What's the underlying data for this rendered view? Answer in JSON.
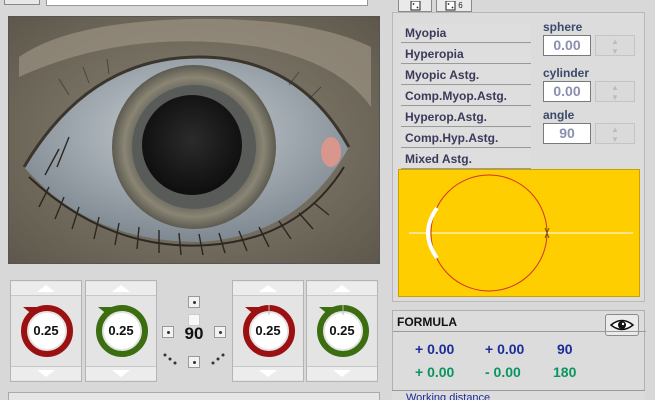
{
  "toolbar": {
    "dice_icon": "die-icon",
    "dice_multi_label": "6"
  },
  "diagnoses": [
    "Myopia",
    "Hyperopia",
    "Myopic Astg.",
    "Comp.Myop.Astg.",
    "Hyperop.Astg.",
    "Comp.Hyp.Astg.",
    "Mixed Astg."
  ],
  "params": {
    "sphere_label": "sphere",
    "sphere_value": "0.00",
    "cylinder_label": "cylinder",
    "cylinder_value": "0.00",
    "angle_label": "angle",
    "angle_value": "90"
  },
  "lenses": [
    {
      "value": "0.25",
      "color": "#9b1111"
    },
    {
      "value": "0.25",
      "color": "#3c6e11"
    },
    {
      "value": "0.25",
      "color": "#9b1111"
    },
    {
      "value": "0.25",
      "color": "#3c6e11"
    }
  ],
  "axis": {
    "value": "90"
  },
  "formula": {
    "title": "FORMULA",
    "row1": [
      "+ 0.00",
      "+ 0.00",
      "90"
    ],
    "row2": [
      "+ 0.00",
      "- 0.00",
      "180"
    ]
  },
  "working_distance": {
    "label": "Working distance"
  },
  "colors": {
    "diagram_bg": "#ffce00",
    "formula_blue": "#1a2d9a",
    "formula_green": "#0a9560"
  }
}
